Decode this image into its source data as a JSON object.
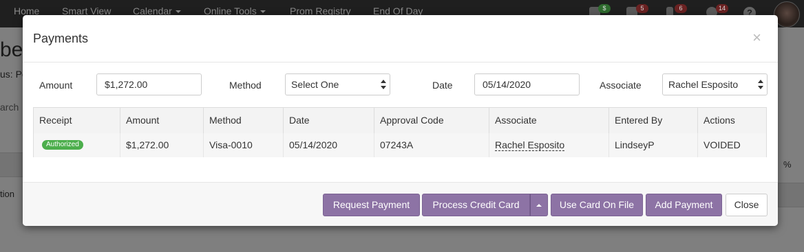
{
  "nav": {
    "items": [
      "Home",
      "Smart View",
      "Calendar",
      "Online Tools",
      "Prom Registry",
      "End Of Day"
    ],
    "badges": [
      "$",
      "5",
      "6",
      "14"
    ],
    "help": "?"
  },
  "background": {
    "title_fragment": "bec",
    "status_fragment": "us: Pe",
    "search_fragment": "arch",
    "action_fragment": "tion",
    "percent_fragment": "%"
  },
  "modal": {
    "title": "Payments",
    "close_glyph": "×",
    "form": {
      "amount_label": "Amount",
      "amount_value": "$1,272.00",
      "method_label": "Method",
      "method_value": "Select One",
      "date_label": "Date",
      "date_value": "05/14/2020",
      "associate_label": "Associate",
      "associate_value": "Rachel Esposito"
    },
    "table": {
      "columns": [
        "Receipt",
        "Amount",
        "Method",
        "Date",
        "Approval Code",
        "Associate",
        "Entered By",
        "Actions"
      ],
      "rows": [
        {
          "receipt": "Authorized",
          "amount": "$1,272.00",
          "method": "Visa-0010",
          "date": "05/14/2020",
          "approval_code": "07243A",
          "associate": "Rachel Esposito",
          "entered_by": "LindseyP",
          "actions": "VOIDED"
        }
      ]
    },
    "footer": {
      "request_payment": "Request Payment",
      "process_credit_card": "Process Credit Card",
      "use_card_on_file": "Use Card On File",
      "add_payment": "Add Payment",
      "close": "Close"
    }
  },
  "colors": {
    "accent_purple": "#8d73a5",
    "status_green": "#4cae4c",
    "navbar": "#1f1f1f"
  }
}
